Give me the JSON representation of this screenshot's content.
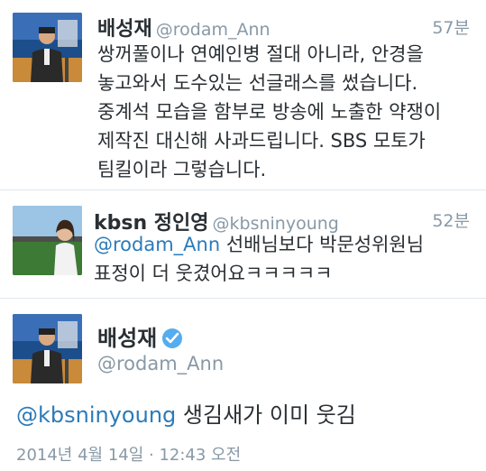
{
  "tweets": [
    {
      "display_name": "배성재",
      "handle": "@rodam_Ann",
      "time": "57분",
      "lines": [
        "쌍꺼풀이나 연예인병 절대 아니라, 안경을",
        "놓고와서 도수있는 선글래스를 썼습니다.",
        "중계석 모습을 함부로 방송에 노출한 약쟁이",
        "제작진 대신해 사과드립니다. SBS 모토가",
        "팀킬이라 그렇습니다."
      ]
    },
    {
      "display_name": "kbsn 정인영",
      "handle": "@kbsninyoung",
      "time": "52분",
      "lines": [
        "@rodam_Ann 선배님보다 박문성위원님",
        "표정이 더 웃겼어요ㅋㅋㅋㅋㅋ"
      ]
    }
  ],
  "main_tweet": {
    "display_name": "배성재",
    "handle": "@rodam_Ann",
    "verified_icon": "verified-badge-icon",
    "mention": "@kbsninyoung",
    "text": " 생김새가 이미 웃김",
    "date": "2014년 4월 14일 · 12:43 오전"
  },
  "colors": {
    "link": "#2b7bb9",
    "muted": "#8899a6",
    "verified": "#55acee",
    "divider": "#e1e8ed"
  }
}
